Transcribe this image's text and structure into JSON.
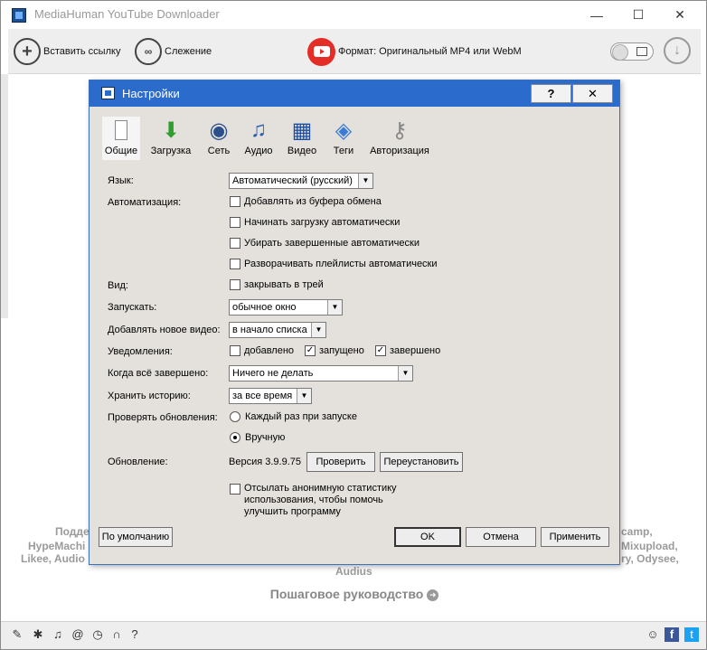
{
  "app": {
    "title": "MediaHuman YouTube Downloader"
  },
  "toolbar": {
    "paste_label": "Вставить ссылку",
    "tracking_label": "Слежение",
    "format_label": "Формат: Оригинальный MP4 или WebM"
  },
  "background": {
    "services_line1": "Подде",
    "services_line1_right": "camp,",
    "services_line2": "HypeMachi",
    "services_line2_right": "Mixupload,",
    "services_line3": "Likee, Audio",
    "services_line3_right": "ry, Odysee,",
    "services_line4": "Audius",
    "guide_label": "Пошаговое руководство"
  },
  "dialog": {
    "title": "Настройки",
    "help_label": "?",
    "close_label": "✕",
    "tabs": [
      {
        "label": "Общие"
      },
      {
        "label": "Загрузка"
      },
      {
        "label": "Сеть"
      },
      {
        "label": "Аудио"
      },
      {
        "label": "Видео"
      },
      {
        "label": "Теги"
      },
      {
        "label": "Авторизация"
      }
    ],
    "language": {
      "label": "Язык:",
      "value": "Автоматический (русский)"
    },
    "automation": {
      "label": "Автоматизация:",
      "options": [
        {
          "label": "Добавлять из буфера обмена",
          "checked": false
        },
        {
          "label": "Начинать загрузку автоматически",
          "checked": false
        },
        {
          "label": "Убирать завершенные автоматически",
          "checked": false
        },
        {
          "label": "Разворачивать плейлисты автоматически",
          "checked": false
        }
      ]
    },
    "view": {
      "label": "Вид:",
      "option": "закрывать в трей"
    },
    "launch": {
      "label": "Запускать:",
      "value": "обычное окно"
    },
    "add_new": {
      "label": "Добавлять новое видео:",
      "value": "в начало списка"
    },
    "notifications": {
      "label": "Уведомления:",
      "added": "добавлено",
      "started": "запущено",
      "finished": "завершено"
    },
    "when_done": {
      "label": "Когда всё завершено:",
      "value": "Ничего не делать"
    },
    "history": {
      "label": "Хранить историю:",
      "value": "за все время"
    },
    "check_updates": {
      "label": "Проверять обновления:",
      "option1": "Каждый раз при запуске",
      "option2": "Вручную"
    },
    "update": {
      "label": "Обновление:",
      "version": "Версия 3.9.9.75",
      "check_button": "Проверить",
      "reinstall_button": "Переустановить"
    },
    "stats": {
      "line1": "Отсылать анонимную статистику",
      "line2": "использования, чтобы помочь",
      "line3": "улучшить программу"
    },
    "buttons": {
      "defaults": "По умолчанию",
      "ok": "OK",
      "cancel": "Отмена",
      "apply": "Применить"
    }
  },
  "colors": {
    "dialog_title": "#2b6bcc",
    "youtube_red": "#e52d27"
  }
}
